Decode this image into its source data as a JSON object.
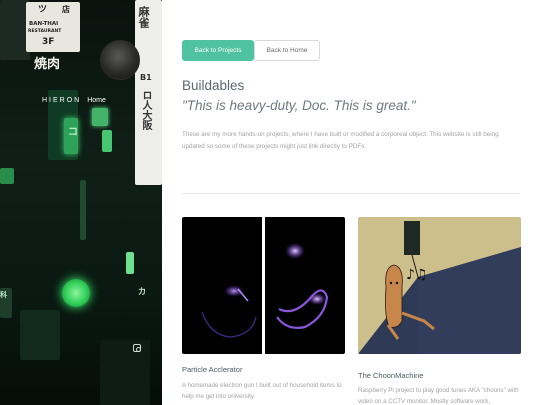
{
  "sidebar": {
    "site_name": "HIERON",
    "home_link": "Home",
    "signs": {
      "ban_thai": "BAN-THAI",
      "restaurant": "RESTAURANT",
      "floor": "3F",
      "yakiniku": "焼肉",
      "tsu": "ツ",
      "ten": "店",
      "ma": "麻雀",
      "b1": "B1",
      "right_column": "ロ人大阪",
      "ko": "コ",
      "ka": "カ",
      "small_left": "科"
    }
  },
  "nav": {
    "projects_label": "Back to Projects",
    "home_label": "Back to Home"
  },
  "page": {
    "title": "Buildables",
    "quote": "\"This is heavy-duty, Doc. This is great.\"",
    "description": "These are my more hands-on projects, where I have built or modified a corporeal object. This website is still being updated so some of these projects might just link directly to PDFs."
  },
  "projects": [
    {
      "title": "Particle Acclerator",
      "description": "A homemade electron gun I built out of household items to help me get into university."
    },
    {
      "title": "The ChoonMachine",
      "description": "Raspberry Pi project to play good tunes AKA \"choons\" with video on a CCTV monitor. Mostly software work,"
    }
  ],
  "colors": {
    "accent": "#4fc3a1",
    "neon_green": "#2fcf57"
  }
}
